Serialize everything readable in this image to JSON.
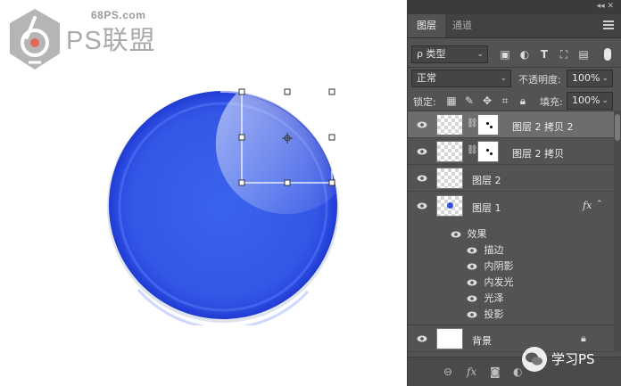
{
  "logo": {
    "site": "68PS.com",
    "brand": "PS联盟"
  },
  "panel": {
    "tabs": [
      "图层",
      "通道"
    ],
    "filter": {
      "label": "ρ 类型"
    },
    "blend_mode": "正常",
    "opacity_label": "不透明度:",
    "opacity_value": "100%",
    "lock_label": "锁定:",
    "fill_label": "填充:",
    "fill_value": "100%",
    "layers": [
      {
        "name": "图层 2 拷贝 2",
        "selected": true
      },
      {
        "name": "图层 2 拷贝",
        "selected": false
      },
      {
        "name": "图层 2",
        "selected": false
      },
      {
        "name": "图层 1",
        "fx": "fx",
        "selected": false
      }
    ],
    "effects_label": "效果",
    "effects": [
      "描边",
      "内阴影",
      "内发光",
      "光泽",
      "投影"
    ],
    "background_layer": "背景"
  },
  "watermark": {
    "text": "学习PS"
  },
  "colors": {
    "sphere": "#3457e6",
    "panel": "#535353",
    "selected_row": "#6d6d6d"
  }
}
